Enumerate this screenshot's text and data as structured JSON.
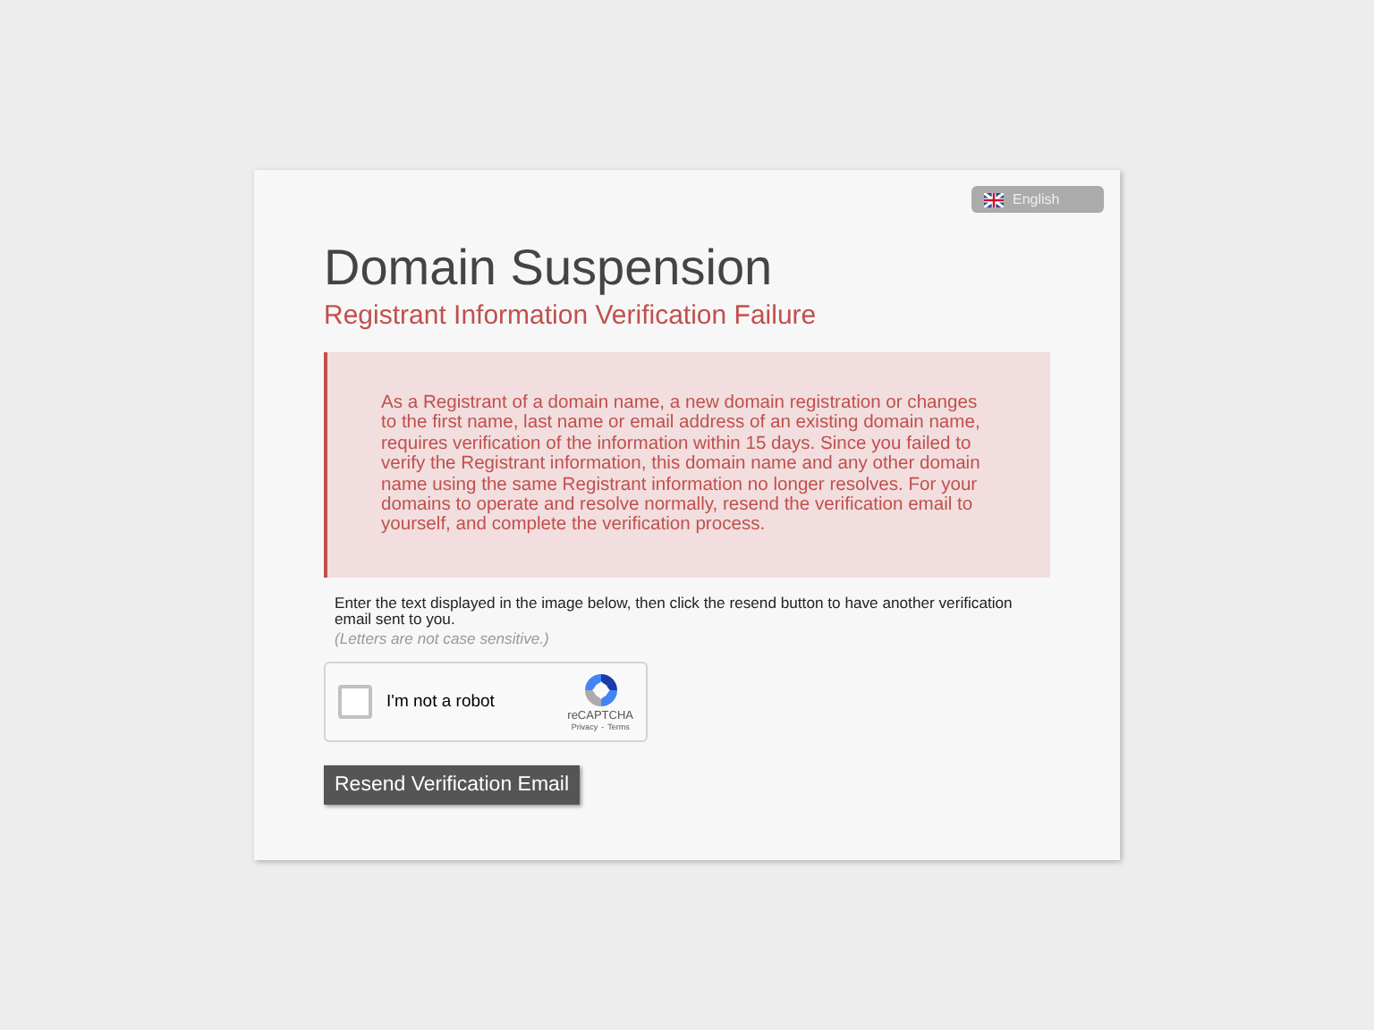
{
  "language": {
    "label": "English"
  },
  "title": "Domain Suspension",
  "subtitle": "Registrant Information Verification Failure",
  "alert": "As a Registrant of a domain name, a new domain registration or changes to the first name, last name or email address of an existing domain name, requires verification of the information within 15 days. Since you failed to verify the Registrant information, this domain name and any other domain name using the same Registrant information no longer resolves. For your domains to operate and resolve normally, resend the verification email to yourself, and complete the verification process.",
  "instructions": "Enter the text displayed in the image below, then click the resend button to have another verification email sent to you.",
  "note": "(Letters are not case sensitive.)",
  "captcha": {
    "label": "I'm not a robot",
    "checked": false,
    "brand": "reCAPTCHA",
    "links": [
      "Privacy",
      "-",
      "Terms"
    ]
  },
  "button": "Resend Verification Email"
}
